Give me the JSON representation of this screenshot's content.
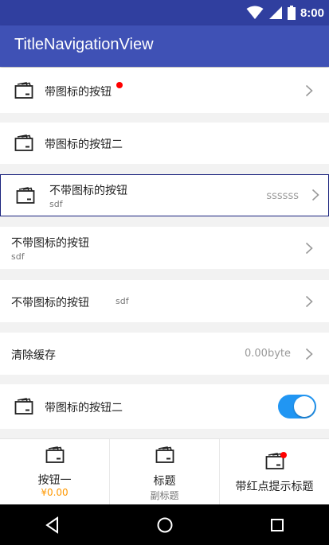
{
  "status": {
    "time": "8:00",
    "icons": [
      "wifi-icon",
      "signal-icon",
      "battery-icon"
    ]
  },
  "appbar": {
    "title": "TitleNavigationView"
  },
  "rows": [
    {
      "label": "带图标的按钮",
      "icon": "wallet-icon",
      "badge": "red-dot",
      "chevron": true
    },
    {
      "label": "带图标的按钮二",
      "icon": "wallet-icon"
    },
    {
      "label": "不带图标的按钮",
      "sub": "sdf",
      "right": "ssssss",
      "icon": "wallet-icon",
      "chevron": true,
      "selected": true
    },
    {
      "label": "不带图标的按钮",
      "sub": "sdf",
      "chevron": true
    },
    {
      "label": "不带图标的按钮",
      "inline_sub": "sdf",
      "chevron": true
    },
    {
      "label": "清除缓存",
      "right": "0.00byte",
      "chevron": true
    },
    {
      "label": "带图标的按钮二",
      "icon": "wallet-icon",
      "toggle": true
    }
  ],
  "tabs": [
    {
      "label": "按钮一",
      "sub": "¥0.00",
      "icon": "wallet-icon"
    },
    {
      "label": "标题",
      "sub": "副标题",
      "icon": "wallet-icon"
    },
    {
      "label": "带红点提示标题",
      "icon": "wallet-icon",
      "badge": "red-dot"
    }
  ],
  "colors": {
    "statusbar": "#303f9f",
    "appbar": "#3f51b5",
    "accent": "#2196f3",
    "price": "#ff9800",
    "badge": "#ff0000"
  },
  "navbar": {
    "icons": [
      "back-icon",
      "home-icon",
      "recents-icon"
    ]
  }
}
